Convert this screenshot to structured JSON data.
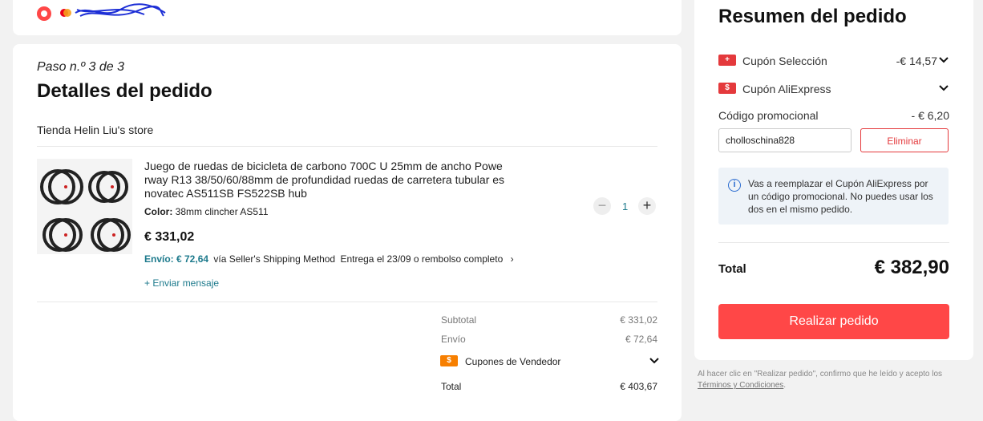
{
  "payment": {
    "selected_icon": "radio-selected-icon",
    "brand_icon": "mastercard-icon"
  },
  "order": {
    "step": "Paso n.º 3 de 3",
    "title": "Detalles del pedido",
    "store": "Tienda Helin Liu's store",
    "product": {
      "name": "Juego de ruedas de bicicleta de carbono 700C U 25mm de ancho Powe rway R13 38/50/60/88mm de profundidad ruedas de carretera tubular es novatec AS511SB FS522SB hub",
      "color_label": "Color:",
      "color_value": "38mm clincher AS511",
      "price": "€ 331,02",
      "shipping_cost": "Envío: € 72,64",
      "shipping_method": "vía Seller's Shipping Method",
      "delivery": "Entrega el 23/09 o rembolso completo",
      "send_message": "+ Enviar mensaje",
      "quantity": "1"
    },
    "summary": {
      "subtotal_label": "Subtotal",
      "subtotal_value": "€ 331,02",
      "shipping_label": "Envío",
      "shipping_value": "€ 72,64",
      "seller_coupons_label": "Cupones de Vendedor",
      "total_label": "Total",
      "total_value": "€ 403,67"
    }
  },
  "order_summary": {
    "title": "Resumen del pedido",
    "coupon_selection_label": "Cupón Selección",
    "coupon_selection_value": "-€ 14,57",
    "coupon_aliexpress_label": "Cupón AliExpress",
    "promo_code_label": "Código promocional",
    "promo_code_value": "- € 6,20",
    "promo_code_input": "cholloschina828",
    "remove_label": "Eliminar",
    "info_text": "Vas a reemplazar el Cupón AliExpress por un código promocional. No puedes usar los dos en el mismo pedido.",
    "total_label": "Total",
    "total_value": "€ 382,90",
    "place_order_label": "Realizar pedido"
  },
  "terms": {
    "text": "Al hacer clic en \"Realizar pedido\", confirmo que he leído y acepto los",
    "link": "Términos y Condiciones",
    "suffix": "."
  },
  "colors": {
    "accent": "#ff4747",
    "link": "#1d7a8c",
    "seller_coupon": "#f77f00"
  }
}
